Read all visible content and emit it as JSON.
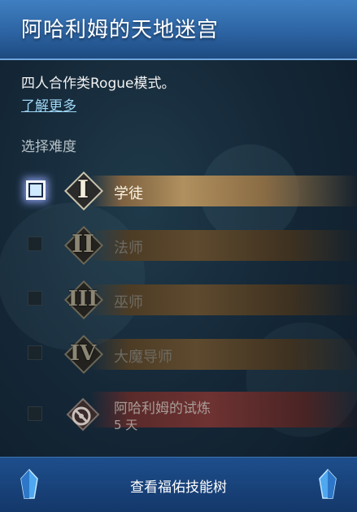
{
  "header": {
    "title": "阿哈利姆的天地迷宫"
  },
  "intro": {
    "description": "四人合作类Rogue模式。",
    "learn_more": "了解更多"
  },
  "difficulty": {
    "label": "选择难度",
    "options": [
      {
        "numeral": "I",
        "label": "学徒",
        "selected": true
      },
      {
        "numeral": "II",
        "label": "法师",
        "selected": false
      },
      {
        "numeral": "III",
        "label": "巫师",
        "selected": false
      },
      {
        "numeral": "IV",
        "label": "大魔导师",
        "selected": false
      },
      {
        "label": "阿哈利姆的试炼",
        "sublabel": "5 天",
        "icon": "locked-trial-icon",
        "selected": false
      }
    ]
  },
  "footer": {
    "button_label": "查看福佑技能树"
  },
  "colors": {
    "header_blue": "#2d64a3",
    "footer_blue": "#1d4e8c",
    "gold": "#b0905e",
    "link": "#9fd6f5"
  }
}
